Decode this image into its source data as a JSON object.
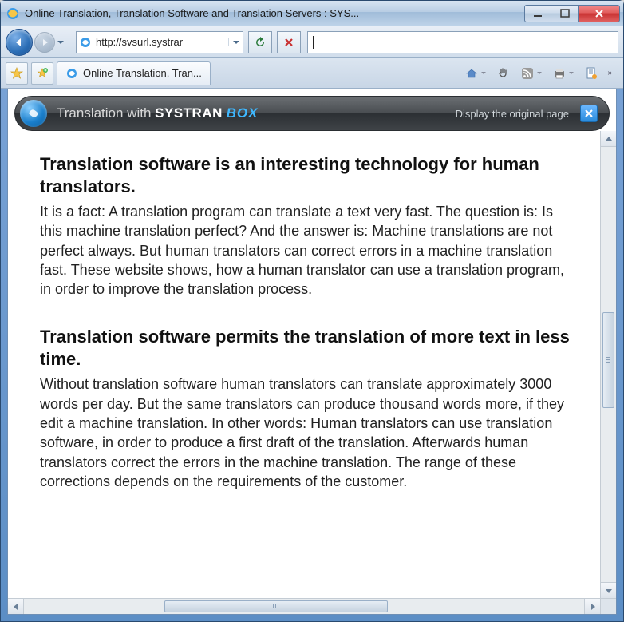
{
  "window": {
    "title": "Online Translation, Translation Software and Translation Servers : SYS..."
  },
  "address_bar": {
    "url": "http://svsurl.systrar"
  },
  "tab": {
    "label": "Online Translation, Tran..."
  },
  "systran_bar": {
    "prefix": "Translation with ",
    "brand_strong": "SYSTRAN",
    "brand_box": "BOX",
    "original_link": "Display the original page"
  },
  "article": {
    "h1": "Translation software is an interesting technology for human translators.",
    "p1": "It is a fact: A translation program can translate a text very fast. The question is: Is this machine translation perfect? And the answer is: Machine translations are not perfect always. But human translators can correct errors in a machine translation fast. These website shows, how a human translator can use a translation program, in order to improve the translation process.",
    "h2": "Translation software permits the translation of more text in less time.",
    "p2": "Without translation software human translators can translate approximately 3000 words per day. But the same translators can produce thousand words more, if they edit a machine translation. In other words: Human translators can use translation software, in order to produce a first draft of the translation. Afterwards human translators correct the errors in the machine translation. The range of these corrections depends on the requirements of the customer."
  }
}
